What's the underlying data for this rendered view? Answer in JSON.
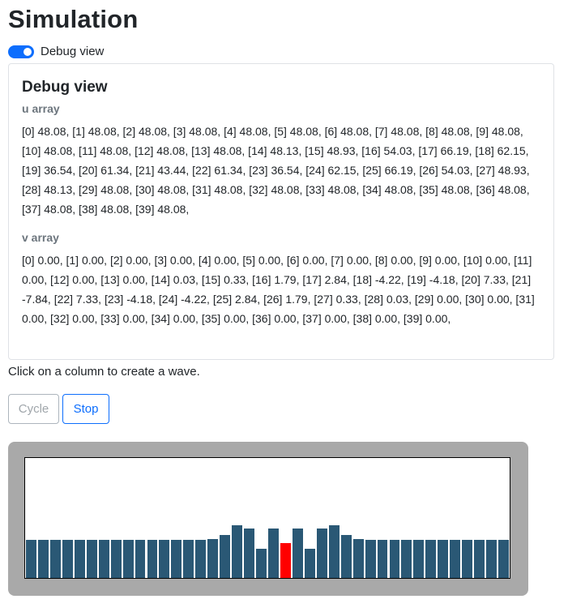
{
  "page": {
    "title": "Simulation",
    "hint": "Click on a column to create a wave."
  },
  "debug_toggle": {
    "label": "Debug view",
    "checked": true
  },
  "debug_card": {
    "title": "Debug view",
    "u_label": "u array",
    "u_text": "[0] 48.08, [1] 48.08, [2] 48.08, [3] 48.08, [4] 48.08, [5] 48.08, [6] 48.08, [7] 48.08, [8] 48.08, [9] 48.08, [10] 48.08, [11] 48.08, [12] 48.08, [13] 48.08, [14] 48.13, [15] 48.93, [16] 54.03, [17] 66.19, [18] 62.15, [19] 36.54, [20] 61.34, [21] 43.44, [22] 61.34, [23] 36.54, [24] 62.15, [25] 66.19, [26] 54.03, [27] 48.93, [28] 48.13, [29] 48.08, [30] 48.08, [31] 48.08, [32] 48.08, [33] 48.08, [34] 48.08, [35] 48.08, [36] 48.08, [37] 48.08, [38] 48.08, [39] 48.08,",
    "v_label": "v array",
    "v_text": "[0] 0.00, [1] 0.00, [2] 0.00, [3] 0.00, [4] 0.00, [5] 0.00, [6] 0.00, [7] 0.00, [8] 0.00, [9] 0.00, [10] 0.00, [11] 0.00, [12] 0.00, [13] 0.00, [14] 0.03, [15] 0.33, [16] 1.79, [17] 2.84, [18] -4.22, [19] -4.18, [20] 7.33, [21] -7.84, [22] 7.33, [23] -4.18, [24] -4.22, [25] 2.84, [26] 1.79, [27] 0.33, [28] 0.03, [29] 0.00, [30] 0.00, [31] 0.00, [32] 0.00, [33] 0.00, [34] 0.00, [35] 0.00, [36] 0.00, [37] 0.00, [38] 0.00, [39] 0.00,"
  },
  "buttons": {
    "cycle": "Cycle",
    "stop": "Stop"
  },
  "simulation": {
    "u_values": [
      48.08,
      48.08,
      48.08,
      48.08,
      48.08,
      48.08,
      48.08,
      48.08,
      48.08,
      48.08,
      48.08,
      48.08,
      48.08,
      48.08,
      48.13,
      48.93,
      54.03,
      66.19,
      62.15,
      36.54,
      61.34,
      43.44,
      61.34,
      36.54,
      62.15,
      66.19,
      54.03,
      48.93,
      48.13,
      48.08,
      48.08,
      48.08,
      48.08,
      48.08,
      48.08,
      48.08,
      48.08,
      48.08,
      48.08,
      48.08
    ],
    "max_value": 150,
    "highlighted_index": 21,
    "bar_color": "#2a5875",
    "highlight_color": "#ff0000"
  }
}
